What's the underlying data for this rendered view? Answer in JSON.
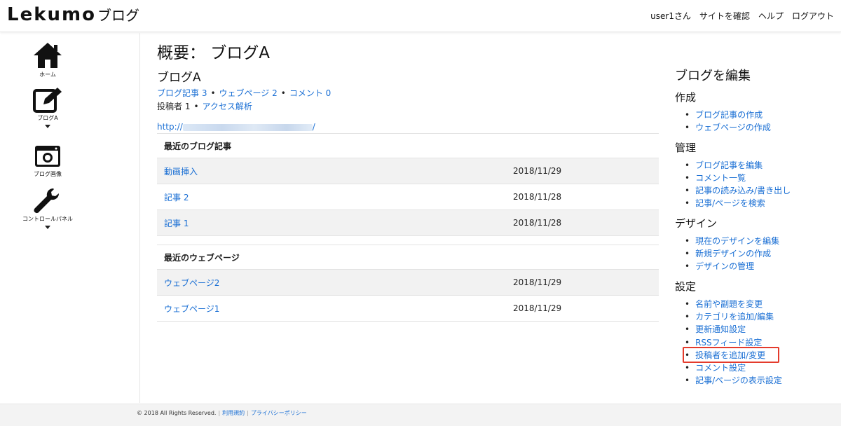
{
  "header": {
    "logo_main": "Lekumo",
    "logo_sub": "ブログ",
    "nav": [
      "user1さん",
      "サイトを確認",
      "ヘルプ",
      "ログアウト"
    ]
  },
  "sidebar": {
    "items": [
      {
        "label": "ホーム",
        "icon": "home-icon"
      },
      {
        "label": "ブログA",
        "icon": "edit-icon"
      },
      {
        "label": "ブログ画像",
        "icon": "camera-icon"
      },
      {
        "label": "コントロールパネル",
        "icon": "wrench-icon"
      }
    ]
  },
  "main": {
    "page_title": "概要： ブログA",
    "blog_name": "ブログA",
    "stats": {
      "entries": "ブログ記事 3",
      "pages": "ウェブページ 2",
      "comments": "コメント 0",
      "authors": "投稿者 1",
      "analytics": "アクセス解析"
    },
    "url_prefix": "http://",
    "url_suffix": "/",
    "recent_entries": {
      "heading": "最近のブログ記事",
      "rows": [
        {
          "title": "動画挿入",
          "date": "2018/11/29"
        },
        {
          "title": "記事 2",
          "date": "2018/11/28"
        },
        {
          "title": "記事 1",
          "date": "2018/11/28"
        }
      ]
    },
    "recent_pages": {
      "heading": "最近のウェブページ",
      "rows": [
        {
          "title": "ウェブページ2",
          "date": "2018/11/29"
        },
        {
          "title": "ウェブページ1",
          "date": "2018/11/29"
        }
      ]
    }
  },
  "right": {
    "title": "ブログを編集",
    "groups": [
      {
        "title": "作成",
        "links": [
          "ブログ記事の作成",
          "ウェブページの作成"
        ]
      },
      {
        "title": "管理",
        "links": [
          "ブログ記事を編集",
          "コメント一覧",
          "記事の読み込み/書き出し",
          "記事/ページを検索"
        ]
      },
      {
        "title": "デザイン",
        "links": [
          "現在のデザインを編集",
          "新規デザインの作成",
          "デザインの管理"
        ]
      },
      {
        "title": "設定",
        "links": [
          "名前や副題を変更",
          "カテゴリを追加/編集",
          "更新通知設定",
          "RSSフィード設定",
          "投稿者を追加/変更",
          "コメント設定",
          "記事/ページの表示設定"
        ]
      }
    ]
  },
  "footer": {
    "copyright": "© 2018 All Rights Reserved.",
    "terms": "利用規約",
    "privacy": "プライバシーポリシー"
  }
}
